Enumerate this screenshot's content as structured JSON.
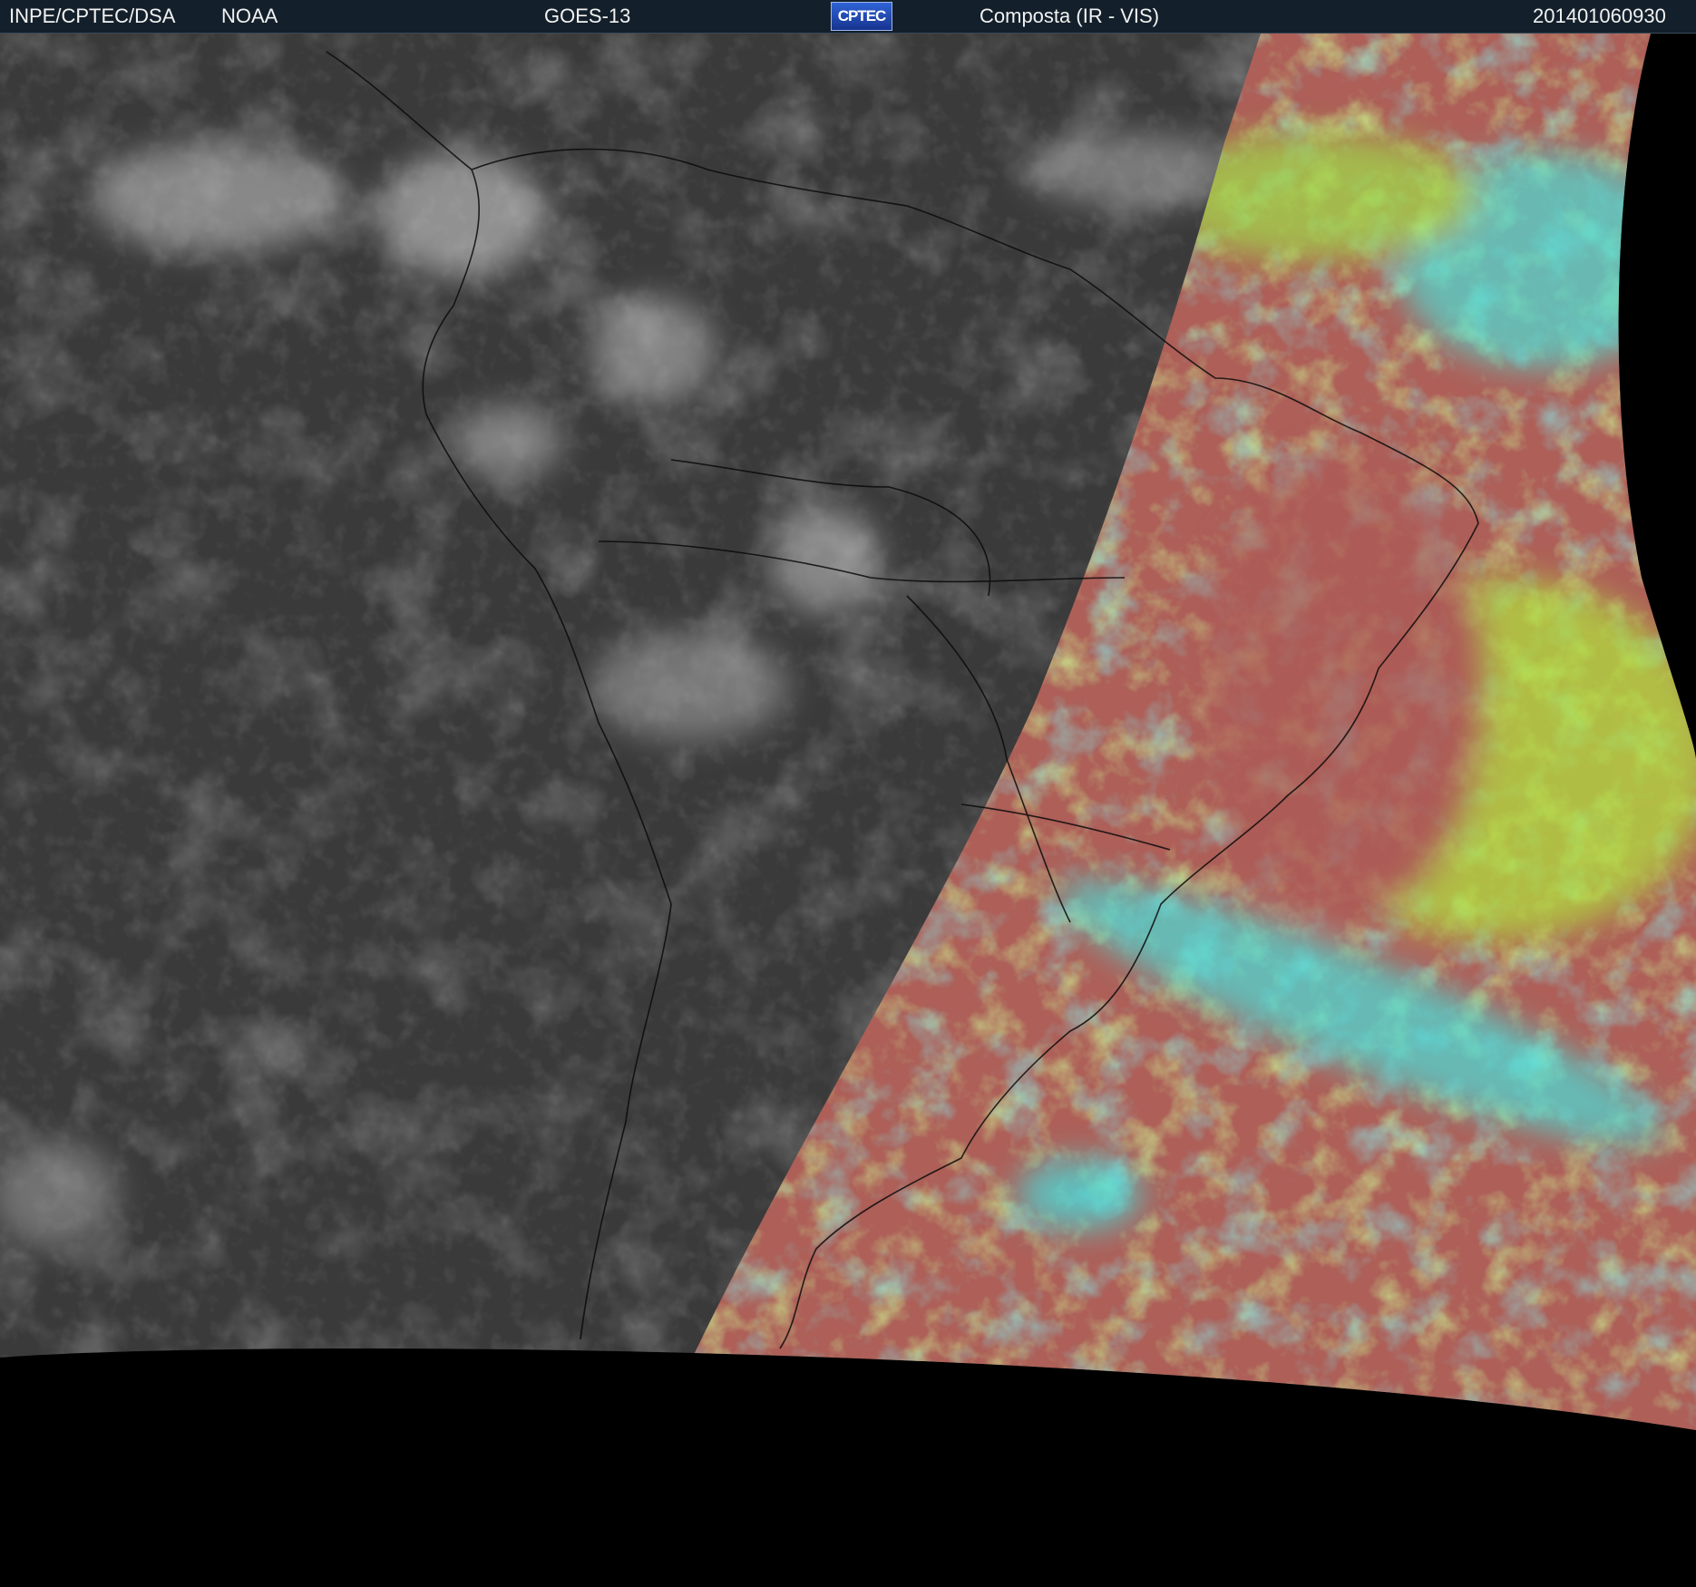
{
  "header": {
    "agency": "INPE/CPTEC/DSA",
    "source": "NOAA",
    "satellite": "GOES-13",
    "logo_text": "CPTEC",
    "product": "Composta (IR - VIS)",
    "datetime": "201401060930"
  },
  "colors": {
    "header_bg": "#13202b",
    "header_text": "#f2f2f2",
    "space_black": "#000000",
    "night_ir_gray": "#3c3c3c",
    "day_ground_red": "#b05a55",
    "day_cloud_cyan": "#3fe3e3",
    "day_cloud_green": "#9ae64a"
  }
}
